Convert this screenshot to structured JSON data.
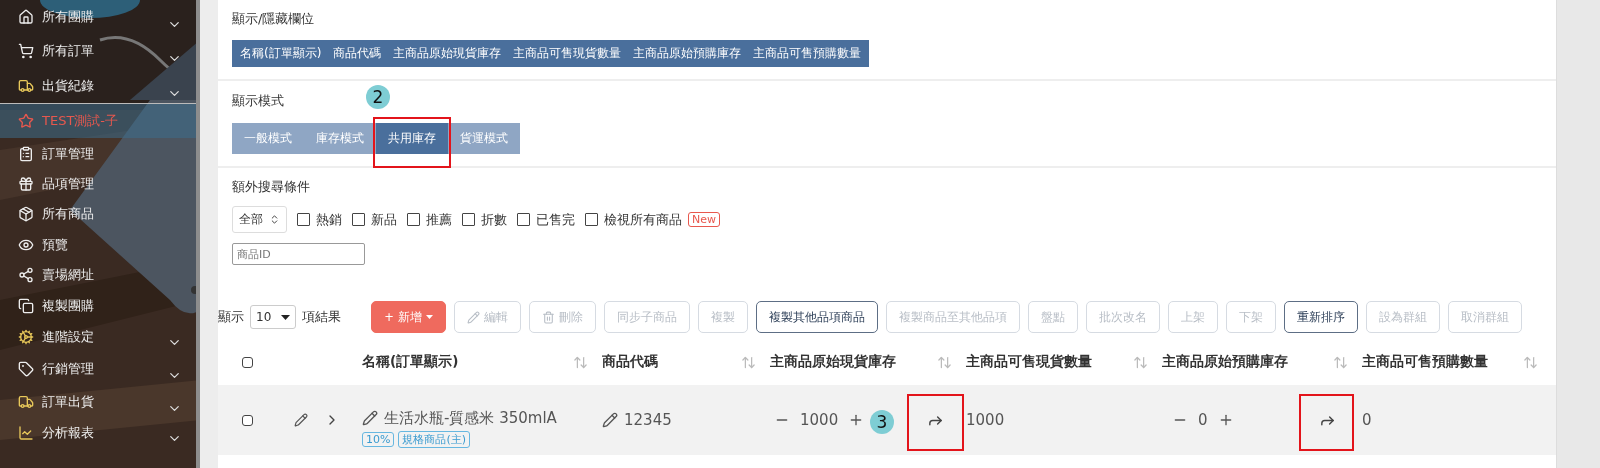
{
  "sidebar": {
    "items": [
      {
        "label": "所有團購",
        "expandable": true,
        "selected": false
      },
      {
        "label": "所有訂單",
        "expandable": true,
        "selected": false
      },
      {
        "label": "出貨紀錄",
        "expandable": true,
        "selected": false
      },
      {
        "label": "TEST測試-子",
        "expandable": false,
        "selected": true
      },
      {
        "label": "訂單管理",
        "expandable": false,
        "selected": false
      },
      {
        "label": "品項管理",
        "expandable": false,
        "selected": false
      },
      {
        "label": "所有商品",
        "expandable": false,
        "selected": false
      },
      {
        "label": "預覽",
        "expandable": false,
        "selected": false
      },
      {
        "label": "賣場網址",
        "expandable": false,
        "selected": false
      },
      {
        "label": "複製團購",
        "expandable": false,
        "selected": false
      },
      {
        "label": "進階設定",
        "expandable": true,
        "selected": false
      },
      {
        "label": "行銷管理",
        "expandable": true,
        "selected": false
      },
      {
        "label": "訂單出貨",
        "expandable": true,
        "selected": false
      },
      {
        "label": "分析報表",
        "expandable": true,
        "selected": false
      }
    ]
  },
  "column_visibility": {
    "title": "顯示/隱藏欄位",
    "columns": [
      {
        "label": "名稱(訂單顯示)",
        "on": true
      },
      {
        "label": "商品代碼",
        "on": true
      },
      {
        "label": "主商品原始現貨庫存",
        "on": true
      },
      {
        "label": "主商品可售現貨數量",
        "on": true
      },
      {
        "label": "主商品原始預購庫存",
        "on": true
      },
      {
        "label": "主商品可售預購數量",
        "on": true
      }
    ]
  },
  "display_mode": {
    "title": "顯示模式",
    "step_marker": "2",
    "tabs": [
      {
        "label": "一般模式",
        "selected": false,
        "highlighted": false
      },
      {
        "label": "庫存模式",
        "selected": false,
        "highlighted": false
      },
      {
        "label": "共用庫存",
        "selected": true,
        "highlighted": true
      },
      {
        "label": "貨運模式",
        "selected": false,
        "highlighted": false
      }
    ]
  },
  "extra_search": {
    "title": "額外搜尋條件",
    "scope_select": "全部",
    "filters": [
      {
        "label": "熱銷",
        "checked": false
      },
      {
        "label": "新品",
        "checked": false
      },
      {
        "label": "推薦",
        "checked": false
      },
      {
        "label": "折數",
        "checked": false
      },
      {
        "label": "已售完",
        "checked": false
      },
      {
        "label": "檢視所有商品",
        "checked": false,
        "badge": "New"
      }
    ],
    "id_field": {
      "placeholder": "商品ID"
    }
  },
  "page_size": {
    "prefix": "顯示",
    "value": "10",
    "suffix": "項結果"
  },
  "toolbar": [
    {
      "label": "+ 新增",
      "kind": "primary",
      "disabled": false
    },
    {
      "label": "編輯",
      "kind": "edit",
      "disabled": true
    },
    {
      "label": "刪除",
      "kind": "delete",
      "disabled": true
    },
    {
      "label": "同步子商品",
      "kind": "plain",
      "disabled": true
    },
    {
      "label": "複製",
      "kind": "plain",
      "disabled": true
    },
    {
      "label": "複製其他品項商品",
      "kind": "plain",
      "disabled": false
    },
    {
      "label": "複製商品至其他品項",
      "kind": "plain",
      "disabled": true
    },
    {
      "label": "盤點",
      "kind": "plain",
      "disabled": true
    },
    {
      "label": "批次改名",
      "kind": "plain",
      "disabled": true
    },
    {
      "label": "上架",
      "kind": "plain",
      "disabled": true
    },
    {
      "label": "下架",
      "kind": "plain",
      "disabled": true
    },
    {
      "label": "重新排序",
      "kind": "plain",
      "disabled": false
    },
    {
      "label": "設為群組",
      "kind": "plain",
      "disabled": true
    },
    {
      "label": "取消群組",
      "kind": "plain",
      "disabled": true
    }
  ],
  "table": {
    "header_checked": false,
    "columns": [
      "名稱(訂單顯示)",
      "商品代碼",
      "主商品原始現貨庫存",
      "主商品可售現貨數量",
      "主商品原始預購庫存",
      "主商品可售預購數量"
    ],
    "rows": [
      {
        "checked": false,
        "step_marker": "3",
        "name": "生活水瓶-質感米 350mlA",
        "tags": [
          "10%",
          "規格商品(主)"
        ],
        "code": "12345",
        "stock": {
          "value": "1000",
          "arrow_highlighted": true
        },
        "available_stock": "1000",
        "preorder": {
          "value": "0",
          "arrow_highlighted": true
        },
        "available_preorder": "0"
      }
    ]
  }
}
